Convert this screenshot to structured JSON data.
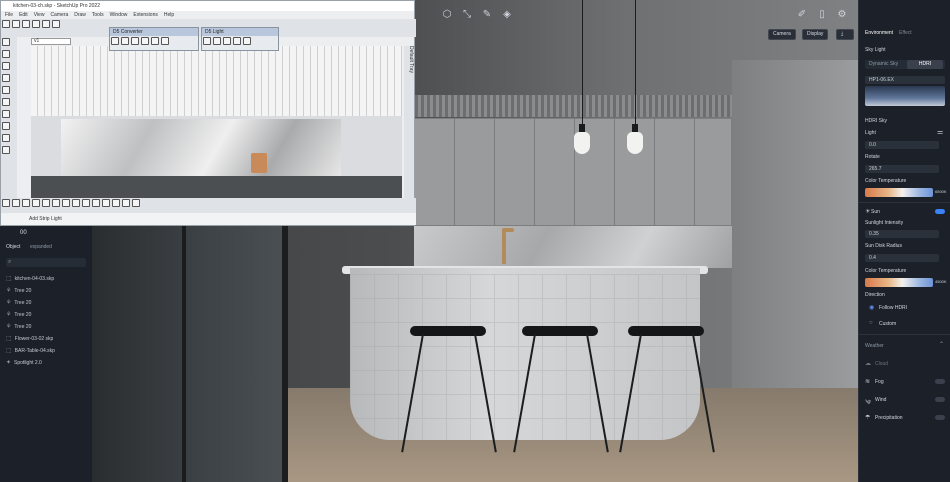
{
  "sketchup": {
    "title": "kitchen-03-ch.skp - SketchUp Pro 2022",
    "menu": [
      "File",
      "Edit",
      "View",
      "Camera",
      "Draw",
      "Tools",
      "Window",
      "Extensions",
      "Help"
    ],
    "float_converter": "D5 Converter",
    "float_light": "D5 Light",
    "add_strip_light": "Add Strip Light",
    "default_tray": "Default Tray",
    "scene_field": "v1"
  },
  "viewport": {
    "camera_label": "Camera",
    "display_label": "Display",
    "export_icon": "download-icon"
  },
  "left_panel": {
    "header": "00",
    "tab_label": "Object",
    "tab_value": "expanded",
    "items": [
      {
        "icon": "object-icon",
        "label": "kitchen-04-03.skp"
      },
      {
        "icon": "tree-icon",
        "label": "Tree 20"
      },
      {
        "icon": "tree-icon",
        "label": "Tree 20"
      },
      {
        "icon": "tree-icon",
        "label": "Tree 20"
      },
      {
        "icon": "tree-icon",
        "label": "Tree 20"
      },
      {
        "icon": "object-icon",
        "label": "Flower-03-02 skp"
      },
      {
        "icon": "object-icon",
        "label": "BAR-Table-04.skp"
      },
      {
        "icon": "light-icon",
        "label": "Spotlight 2.0"
      }
    ]
  },
  "right_panel": {
    "tabs": [
      "Environment",
      "Effect"
    ],
    "sky_light": "Sky Light",
    "sky_options": [
      "Dynamic Sky",
      "HDRI"
    ],
    "hdri_name": "HP1-06.EX",
    "hdri_sky": "HDRI Sky",
    "light_label": "Light",
    "light_value": "0.0",
    "rotate_label": "Rotate",
    "rotate_value": "265.7",
    "color_temp_label": "Color Temperature",
    "color_temp_value": "6500K",
    "sun_label": "Sun",
    "sunlight_label": "Sunlight Intensity",
    "sunlight_value": "0.35",
    "sun_disk_label": "Sun Disk Radius",
    "sun_disk_value": "0.4",
    "sun_temp_label": "Color Temperature",
    "sun_temp_value": "4500K",
    "direction_label": "Direction",
    "follow_hdri": "Follow HDRI",
    "custom": "Custom",
    "weather_label": "Weather",
    "cloud": "Cloud",
    "fog": "Fog",
    "wind": "Wind",
    "precipitation": "Precipitation"
  }
}
